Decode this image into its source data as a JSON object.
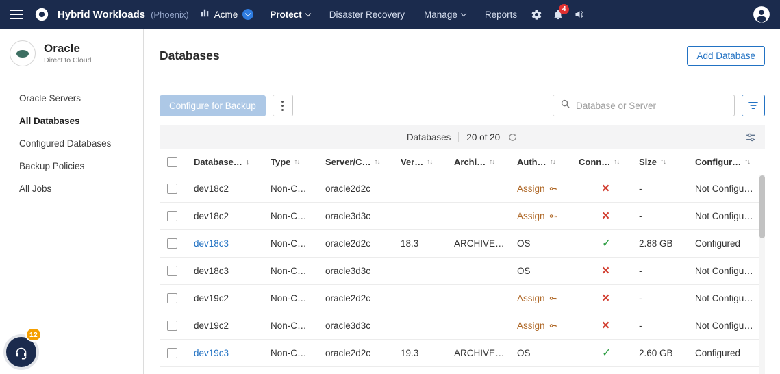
{
  "navbar": {
    "product": "Hybrid Workloads",
    "org_unit": "(Phoenix)",
    "tenant": "Acme",
    "menu": [
      {
        "label": "Protect"
      },
      {
        "label": "Disaster Recovery"
      },
      {
        "label": "Manage"
      },
      {
        "label": "Reports"
      }
    ],
    "notifications": "4"
  },
  "sidebar": {
    "service_name": "Oracle",
    "service_subtitle": "Direct to Cloud",
    "items": [
      "Oracle Servers",
      "All Databases",
      "Configured Databases",
      "Backup Policies",
      "All Jobs"
    ],
    "active_item": "All Databases",
    "help_badge": "12"
  },
  "page": {
    "title": "Databases",
    "add_database_button": "Add Database",
    "configure_button": "Configure for Backup",
    "search_placeholder": "Database or Server",
    "caption_name": "Databases",
    "caption_count": "20 of 20"
  },
  "table": {
    "columns": [
      "Database…",
      "Type",
      "Server/C…",
      "Ver…",
      "Archi…",
      "Auth…",
      "Conn…",
      "Size",
      "Configur…"
    ],
    "rows": [
      {
        "database": "dev18c2",
        "type": "Non-C…",
        "server": "oracle2d2c",
        "version": "",
        "archive": "",
        "auth": "Assign",
        "connected": "no",
        "size": "-",
        "config": "Not Configu…"
      },
      {
        "database": "dev18c2",
        "type": "Non-C…",
        "server": "oracle3d3c",
        "version": "",
        "archive": "",
        "auth": "Assign",
        "connected": "no",
        "size": "-",
        "config": "Not Configu…"
      },
      {
        "database": "dev18c3",
        "type": "Non-C…",
        "server": "oracle2d2c",
        "version": "18.3",
        "archive": "ARCHIVE…",
        "auth": "OS",
        "connected": "yes",
        "size": "2.88 GB",
        "config": "Configured"
      },
      {
        "database": "dev18c3",
        "type": "Non-C…",
        "server": "oracle3d3c",
        "version": "",
        "archive": "",
        "auth": "OS",
        "connected": "no",
        "size": "-",
        "config": "Not Configu…"
      },
      {
        "database": "dev19c2",
        "type": "Non-C…",
        "server": "oracle2d2c",
        "version": "",
        "archive": "",
        "auth": "Assign",
        "connected": "no",
        "size": "-",
        "config": "Not Configu…"
      },
      {
        "database": "dev19c2",
        "type": "Non-C…",
        "server": "oracle3d3c",
        "version": "",
        "archive": "",
        "auth": "Assign",
        "connected": "no",
        "size": "-",
        "config": "Not Configu…"
      },
      {
        "database": "dev19c3",
        "type": "Non-C…",
        "server": "oracle2d2c",
        "version": "19.3",
        "archive": "ARCHIVE…",
        "auth": "OS",
        "connected": "yes",
        "size": "2.60 GB",
        "config": "Configured"
      }
    ]
  },
  "icons": {
    "sort_asc": "↑",
    "sort_desc": "↓",
    "check": "✓",
    "cross": "×"
  },
  "colors": {
    "navbar": "#1b2b4d",
    "accent": "#2272c3",
    "success": "#2f9e44",
    "error": "#d23f31",
    "assign_link": "#b06a2a",
    "badge_red": "#e03131",
    "badge_orange": "#f59f00"
  }
}
